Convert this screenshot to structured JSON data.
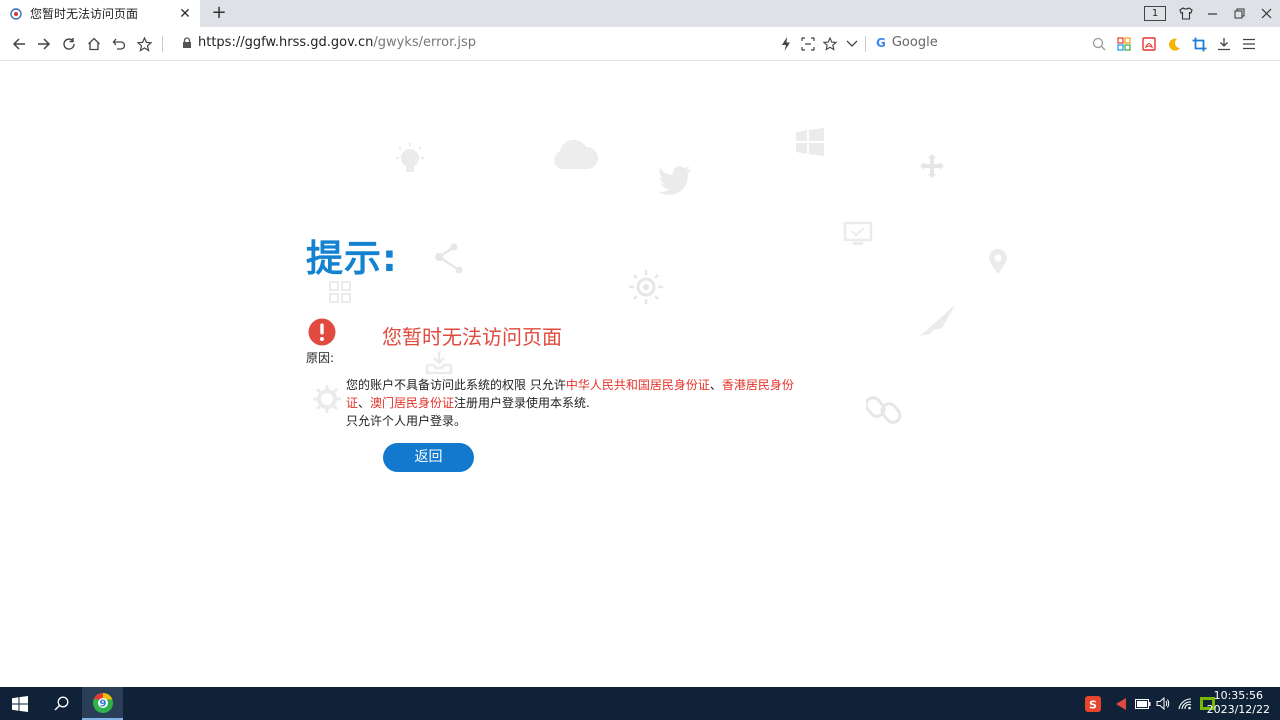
{
  "browser": {
    "tab": {
      "title": "您暂时无法访问页面",
      "close_glyph": "✕"
    },
    "new_tab_glyph": "+",
    "tab_count": "1",
    "address": {
      "host": "https://ggfw.hrss.gd.gov.cn",
      "path": "/gwyks/error.jsp"
    },
    "search": {
      "engine": "Google"
    }
  },
  "page": {
    "heading": "提示:",
    "error_title": "您暂时无法访问页面",
    "reason_label": "原因:",
    "reason": {
      "part1": "您的账户不具备访问此系统的权限 只允许",
      "red1": "中华人民共和国居民身份证",
      "sep1": "、",
      "red2": "香港居民身份证",
      "sep2": "、",
      "red3": "澳门居民身份证",
      "part2": "注册用户登录使用本系统.",
      "line2": "只允许个人用户登录。"
    },
    "back_button": "返回"
  },
  "taskbar": {
    "time": "10:35:56",
    "date": "2023/12/22"
  },
  "colors": {
    "accent": "#1382d1",
    "error": "#e04a3f",
    "highlight": "#e5332a",
    "taskbar": "#0f2238"
  }
}
